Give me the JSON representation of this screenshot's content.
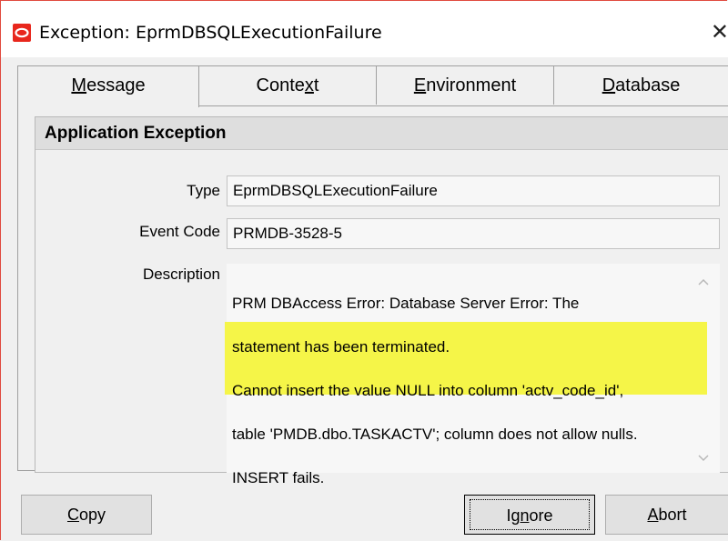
{
  "window": {
    "title": "Exception: EprmDBSQLExecutionFailure",
    "close_glyph": "✕",
    "accent_color": "#e8271d"
  },
  "tabs": [
    {
      "label_pre": "",
      "label_mnemonic": "M",
      "label_post": "essage",
      "active": true
    },
    {
      "label_pre": "Conte",
      "label_mnemonic": "x",
      "label_post": "t",
      "active": false
    },
    {
      "label_pre": "",
      "label_mnemonic": "E",
      "label_post": "nvironment",
      "active": false
    },
    {
      "label_pre": "",
      "label_mnemonic": "D",
      "label_post": "atabase",
      "active": false
    }
  ],
  "group": {
    "title": "Application Exception",
    "type_label": "Type",
    "type_value": "EprmDBSQLExecutionFailure",
    "event_code_label": "Event Code",
    "event_code_value": "PRMDB-3528-5",
    "description_label": "Description",
    "description_line1": "PRM DBAccess Error: Database Server Error: The",
    "description_line2": "statement has been terminated.",
    "description_line3": "Cannot insert the value NULL into column 'actv_code_id',",
    "description_line4": "table 'PMDB.dbo.TASKACTV'; column does not allow nulls.",
    "description_line5": "INSERT fails.",
    "highlight_color": "#f5f548"
  },
  "buttons": {
    "copy_mnemonic": "C",
    "copy_rest": "opy",
    "ignore_pre": "Ig",
    "ignore_mnemonic": "n",
    "ignore_post": "ore",
    "abort_mnemonic": "A",
    "abort_rest": "bort"
  },
  "icons": {
    "app": "oracle-logo-icon",
    "close": "close-icon",
    "scroll_up": "chevron-up-icon",
    "scroll_down": "chevron-down-icon"
  }
}
